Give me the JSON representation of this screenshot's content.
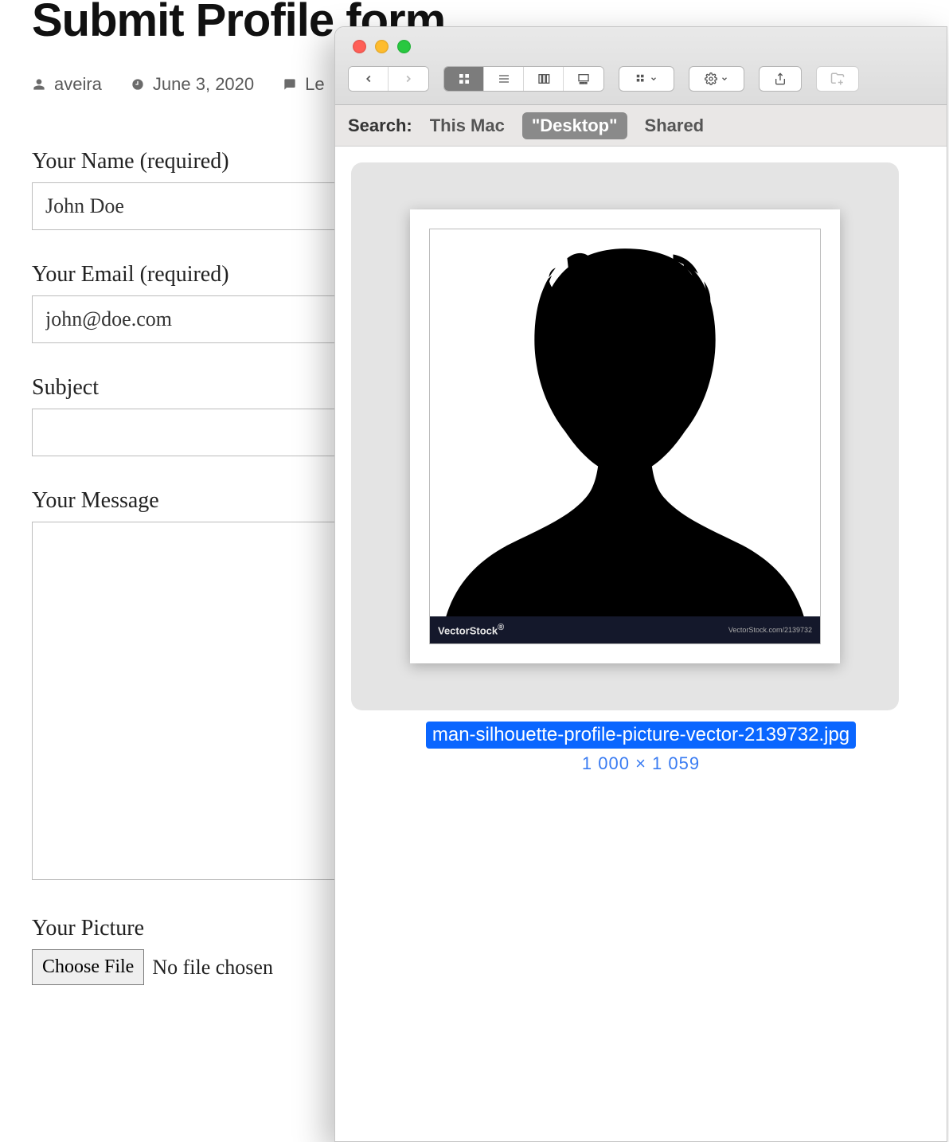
{
  "page": {
    "title": "Submit Profile form",
    "meta": {
      "author": "aveira",
      "date": "June 3, 2020",
      "comments_partial": "Le"
    }
  },
  "form": {
    "name_label": "Your Name (required)",
    "name_value": "John Doe",
    "email_label": "Your Email (required)",
    "email_value": "john@doe.com",
    "subject_label": "Subject",
    "subject_value": "",
    "message_label": "Your Message",
    "message_value": "",
    "picture_label": "Your Picture",
    "choose_file_label": "Choose File",
    "no_file_label": "No file chosen"
  },
  "finder": {
    "searchbar": {
      "label": "Search:",
      "scope_this_mac": "This Mac",
      "scope_desktop": "\"Desktop\"",
      "scope_shared": "Shared"
    },
    "file": {
      "name": "man-silhouette-profile-picture-vector-2139732.jpg",
      "dimensions": "1 000 × 1 059",
      "watermark_brand": "VectorStock",
      "watermark_attr": "VectorStock.com/2139732"
    }
  }
}
